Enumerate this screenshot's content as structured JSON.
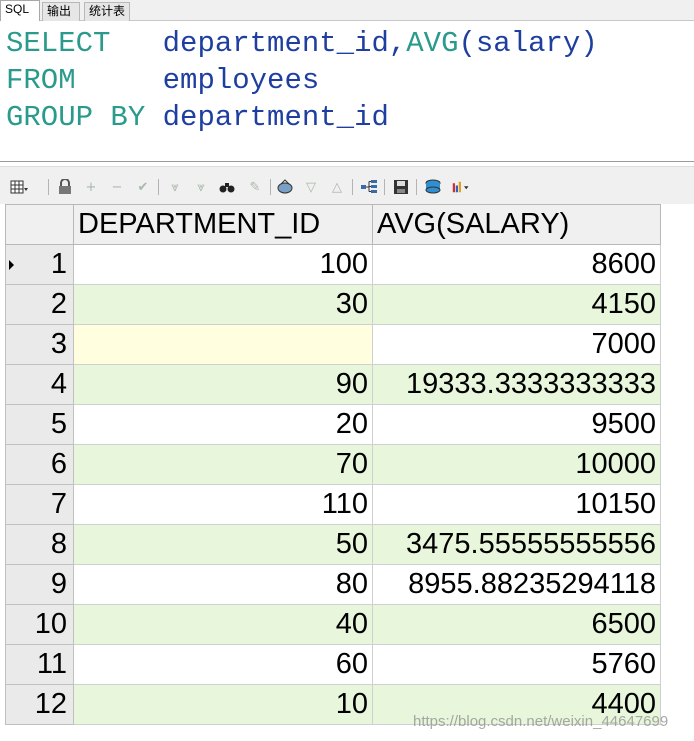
{
  "tabs": [
    "SQL",
    "输出",
    "统计表"
  ],
  "editor": {
    "lines": [
      {
        "keyword": "SELECT",
        "pad": "   ",
        "rest_a": "department_id,",
        "func": "AVG",
        "rest_b": "(salary)"
      },
      {
        "keyword": "FROM",
        "pad": "     ",
        "rest_a": "employees",
        "func": "",
        "rest_b": ""
      },
      {
        "keyword": "GROUP BY",
        "pad": " ",
        "rest_a": "department_id",
        "func": "",
        "rest_b": ""
      }
    ]
  },
  "toolbar": {
    "icons": [
      "grid-view-icon",
      "lock-icon",
      "add-row-icon",
      "delete-row-icon",
      "post-icon",
      "next-icon",
      "last-icon",
      "find-icon",
      "clear-icon",
      "refresh-icon",
      "filter-down-icon",
      "filter-up-icon",
      "tree-icon",
      "save-icon",
      "export-icon",
      "chart-icon"
    ]
  },
  "grid": {
    "columns": [
      "DEPARTMENT_ID",
      "AVG(SALARY)"
    ],
    "rows": [
      {
        "n": "1",
        "dept": "100",
        "avg": "8600"
      },
      {
        "n": "2",
        "dept": "30",
        "avg": "4150"
      },
      {
        "n": "3",
        "dept": "",
        "avg": "7000"
      },
      {
        "n": "4",
        "dept": "90",
        "avg": "19333.3333333333"
      },
      {
        "n": "5",
        "dept": "20",
        "avg": "9500"
      },
      {
        "n": "6",
        "dept": "70",
        "avg": "10000"
      },
      {
        "n": "7",
        "dept": "110",
        "avg": "10150"
      },
      {
        "n": "8",
        "dept": "50",
        "avg": "3475.55555555556"
      },
      {
        "n": "9",
        "dept": "80",
        "avg": "8955.88235294118"
      },
      {
        "n": "10",
        "dept": "40",
        "avg": "6500"
      },
      {
        "n": "11",
        "dept": "60",
        "avg": "5760"
      },
      {
        "n": "12",
        "dept": "10",
        "avg": "4400"
      }
    ]
  },
  "watermark": "https://blog.csdn.net/weixin_44647699",
  "colors": {
    "keyword": "#2a9a8c",
    "identifier": "#1f3fa0",
    "row_alt": "#e8f6dc",
    "null_cell": "#ffffe0"
  }
}
